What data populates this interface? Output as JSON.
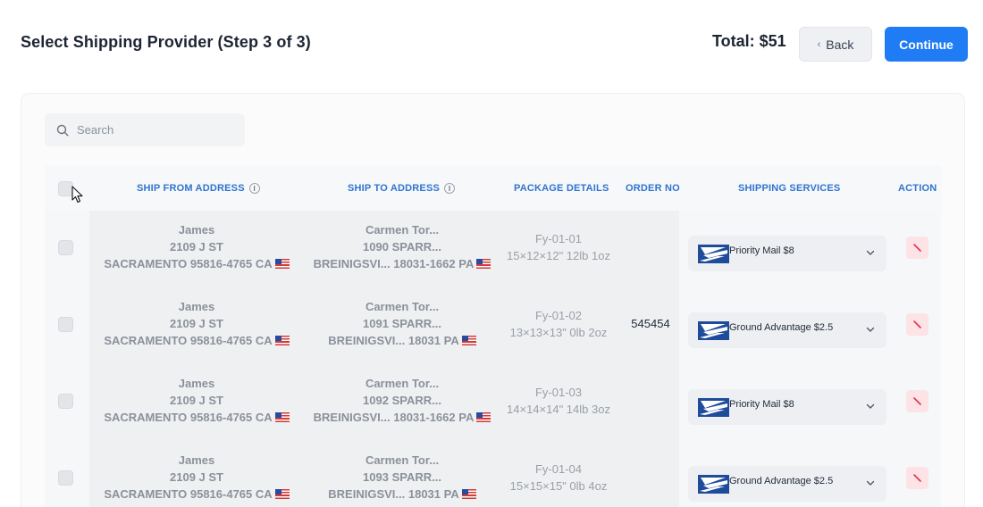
{
  "header": {
    "title": "Select Shipping Provider (Step 3 of 3)",
    "total": "Total: $51",
    "back_label": "Back",
    "continue_label": "Continue"
  },
  "search": {
    "placeholder": "Search"
  },
  "table": {
    "columns": [
      "SHIP FROM ADDRESS",
      "SHIP TO ADDRESS",
      "PACKAGE DETAILS",
      "ORDER NO",
      "SHIPPING SERVICES",
      "ACTION"
    ],
    "rows": [
      {
        "from_name": "James",
        "from_street": "2109 J ST",
        "from_city": "SACRAMENTO 95816-4765 CA",
        "to_name": "Carmen Tor...",
        "to_street": "1090 SPARR...",
        "to_city": "BREINIGSVI... 18031-1662 PA",
        "pkg_id": "Fy-01-01",
        "pkg_dims": "15×12×12\" 12lb 1oz",
        "order_no": "",
        "service": "Priority Mail $8"
      },
      {
        "from_name": "James",
        "from_street": "2109 J ST",
        "from_city": "SACRAMENTO 95816-4765 CA",
        "to_name": "Carmen Tor...",
        "to_street": "1091 SPARR...",
        "to_city": "BREINIGSVI... 18031 PA",
        "pkg_id": "Fy-01-02",
        "pkg_dims": "13×13×13\" 0lb 2oz",
        "order_no": "545454",
        "service": "Ground Advantage $2.5"
      },
      {
        "from_name": "James",
        "from_street": "2109 J ST",
        "from_city": "SACRAMENTO 95816-4765 CA",
        "to_name": "Carmen Tor...",
        "to_street": "1092 SPARR...",
        "to_city": "BREINIGSVI... 18031-1662 PA",
        "pkg_id": "Fy-01-03",
        "pkg_dims": "14×14×14\" 14lb 3oz",
        "order_no": "",
        "service": "Priority Mail $8"
      },
      {
        "from_name": "James",
        "from_street": "2109 J ST",
        "from_city": "SACRAMENTO 95816-4765 CA",
        "to_name": "Carmen Tor...",
        "to_street": "1093 SPARR...",
        "to_city": "BREINIGSVI... 18031 PA",
        "pkg_id": "Fy-01-04",
        "pkg_dims": "15×15×15\" 0lb 4oz",
        "order_no": "",
        "service": "Ground Advantage $2.5"
      }
    ]
  },
  "icons": {
    "search": "search-icon",
    "back": "chevron-left-icon",
    "info": "info-icon",
    "flag": "us-flag-icon",
    "carrier": "usps-eagle-logo",
    "dropdown": "chevron-down-icon",
    "delete": "close-icon",
    "cursor": "mouse-pointer-icon"
  },
  "colors": {
    "accent": "#1f7cf5",
    "header_text": "#2f74d0",
    "delete_bg": "#fde3e6",
    "delete_icon": "#e0344d",
    "usps_blue": "#1f4b9b"
  }
}
